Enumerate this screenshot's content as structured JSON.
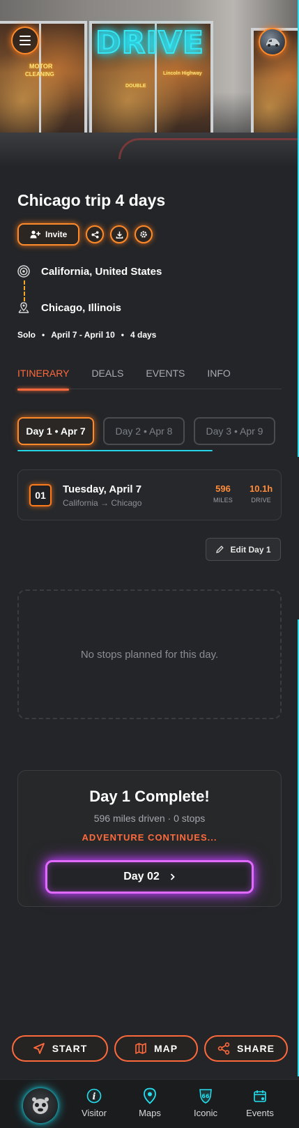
{
  "app": {
    "logo": "DRIVE"
  },
  "hero": {
    "signs": [
      "MOTOR",
      "CLEANING",
      "Lincoln Highway",
      "DOUBLE"
    ]
  },
  "trip": {
    "title": "Chicago trip 4 days",
    "invite_label": "Invite",
    "origin": "California, United States",
    "destination": "Chicago, Illinois",
    "meta": {
      "travelers": "Solo",
      "dates": "April 7 - April 10",
      "duration": "4 days"
    }
  },
  "tabs": [
    {
      "label": "ITINERARY",
      "active": true
    },
    {
      "label": "DEALS",
      "active": false
    },
    {
      "label": "EVENTS",
      "active": false
    },
    {
      "label": "INFO",
      "active": false
    }
  ],
  "days": [
    {
      "label": "Day 1 • Apr 7",
      "active": true
    },
    {
      "label": "Day 2 • Apr 8",
      "active": false
    },
    {
      "label": "Day 3 • Apr 9",
      "active": false
    }
  ],
  "day_card": {
    "number": "01",
    "date": "Tuesday, April 7",
    "route": "California → Chicago",
    "miles_value": "596",
    "miles_label": "MILES",
    "drive_value": "10.1h",
    "drive_label": "DRIVE"
  },
  "edit_button": "Edit Day 1",
  "empty_message": "No stops planned for this day.",
  "complete": {
    "heading": "Day 1 Complete!",
    "summary": "596 miles driven · 0 stops",
    "continue_text": "ADVENTURE CONTINUES...",
    "next_label": "Day 02"
  },
  "action_bar": {
    "start": "START",
    "map": "MAP",
    "share": "SHARE"
  },
  "bottom_nav": [
    {
      "label": "Visitor",
      "icon": "info-icon"
    },
    {
      "label": "Maps",
      "icon": "map-pin-icon"
    },
    {
      "label": "Iconic",
      "icon": "route-66-icon"
    },
    {
      "label": "Events",
      "icon": "calendar-icon"
    }
  ],
  "colors": {
    "accent_orange": "#ff8a2a",
    "tab_active": "#ff6a3d",
    "neon_cyan": "#25e0f0",
    "neon_magenta": "#e26bff",
    "background": "#232528"
  }
}
